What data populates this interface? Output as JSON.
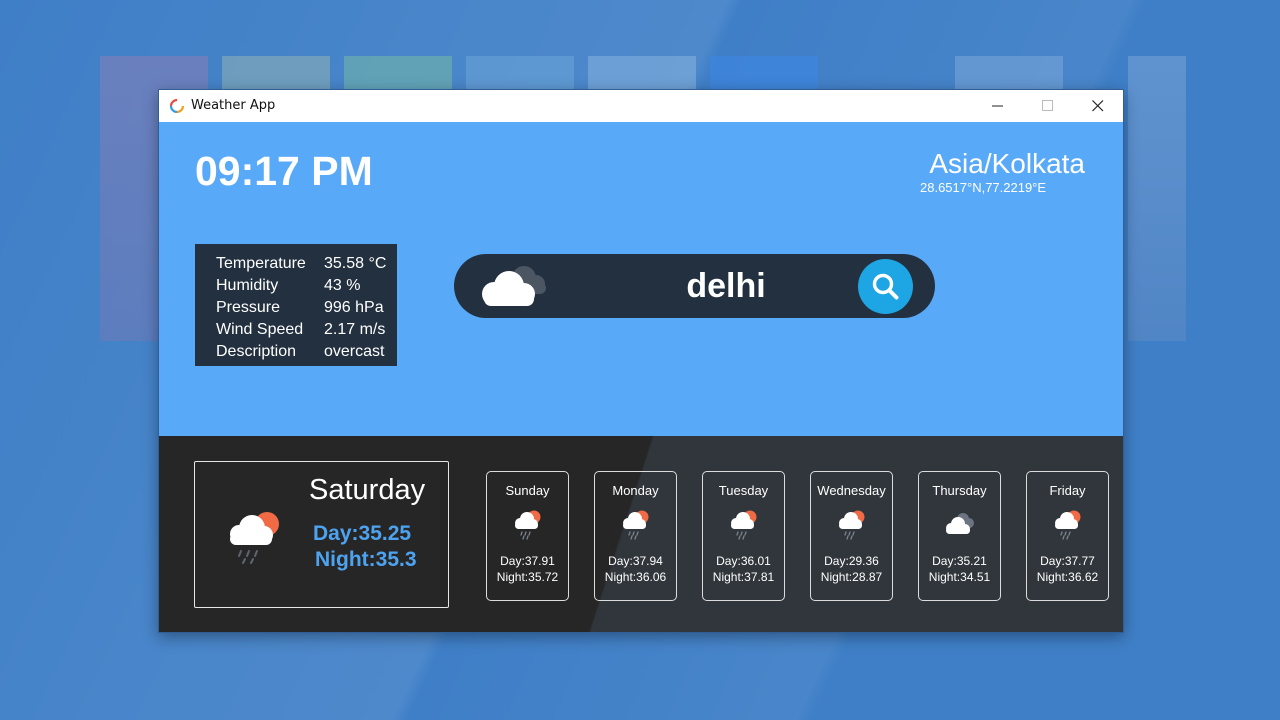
{
  "window": {
    "title": "Weather App"
  },
  "header": {
    "time": "09:17 PM",
    "timezone": "Asia/Kolkata",
    "coordinates": "28.6517°N,77.2219°E"
  },
  "details": [
    {
      "label": "Temperature",
      "value": "35.58 °C"
    },
    {
      "label": "Humidity",
      "value": "43 %"
    },
    {
      "label": "Pressure",
      "value": "996 hPa"
    },
    {
      "label": "Wind Speed",
      "value": "2.17 m/s"
    },
    {
      "label": "Description",
      "value": "overcast"
    }
  ],
  "search": {
    "value": "delhi",
    "icon": "cloud-icon",
    "button_icon": "search-icon"
  },
  "today": {
    "day": "Saturday",
    "day_temp": "Day:35.25",
    "night_temp": "Night:35.3",
    "icon": "sun-cloud-rain-icon"
  },
  "forecast": [
    {
      "day": "Sunday",
      "day_temp": "Day:37.91",
      "night_temp": "Night:35.72",
      "icon": "sun-cloud-rain-icon"
    },
    {
      "day": "Monday",
      "day_temp": "Day:37.94",
      "night_temp": "Night:36.06",
      "icon": "sun-cloud-rain-icon"
    },
    {
      "day": "Tuesday",
      "day_temp": "Day:36.01",
      "night_temp": "Night:37.81",
      "icon": "sun-cloud-rain-icon"
    },
    {
      "day": "Wednesday",
      "day_temp": "Day:29.36",
      "night_temp": "Night:28.87",
      "icon": "sun-cloud-rain-icon"
    },
    {
      "day": "Thursday",
      "day_temp": "Day:35.21",
      "night_temp": "Night:34.51",
      "icon": "cloud-icon"
    },
    {
      "day": "Friday",
      "day_temp": "Day:37.77",
      "night_temp": "Night:36.62",
      "icon": "sun-cloud-rain-icon"
    }
  ],
  "colors": {
    "top_panel": "#59a9f9",
    "dark_panel": "#22303f",
    "bottom_panel": "#262626",
    "accent": "#1ea5e3",
    "today_temp": "#4ea3f0"
  }
}
